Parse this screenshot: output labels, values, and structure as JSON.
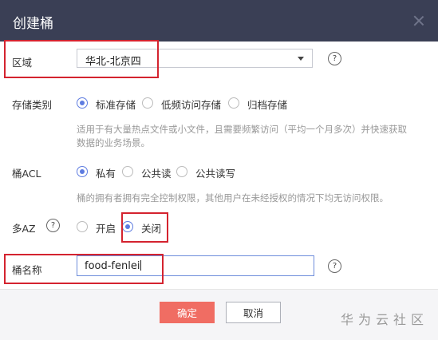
{
  "dialog": {
    "title": "创建桶",
    "close_icon": "close-icon"
  },
  "region": {
    "label": "区域",
    "value": "华北-北京四",
    "help_icon": "question-circle-icon"
  },
  "storage_class": {
    "label": "存储类别",
    "options": [
      "标准存储",
      "低频访问存储",
      "归档存储"
    ],
    "selected": "标准存储",
    "hint": "适用于有大量热点文件或小文件，且需要频繁访问（平均一个月多次）并快速获取数据的业务场景。",
    "hint_line1": "适用于有大量热点文件或小文件，且需要频繁访问（平均一个月多次）并快速获取",
    "hint_line2": "数据的业务场景。"
  },
  "bucket_acl": {
    "label": "桶ACL",
    "options": [
      "私有",
      "公共读",
      "公共读写"
    ],
    "selected": "私有",
    "hint": "桶的拥有者拥有完全控制权限，其他用户在未经授权的情况下均无访问权限。"
  },
  "multi_az": {
    "label": "多AZ",
    "options": [
      "开启",
      "关闭"
    ],
    "selected": "关闭",
    "help_icon": "question-circle-icon"
  },
  "bucket_name": {
    "label": "桶名称",
    "value": "food-fenlei",
    "help_icon": "question-circle-icon"
  },
  "footer": {
    "ok_label": "确定",
    "cancel_label": "取消",
    "watermark": "华为云社区"
  },
  "colors": {
    "titlebar": "#3a3f55",
    "accent": "#5e7ce0",
    "primary_button": "#f06d63",
    "highlight_box": "#d4232f"
  }
}
